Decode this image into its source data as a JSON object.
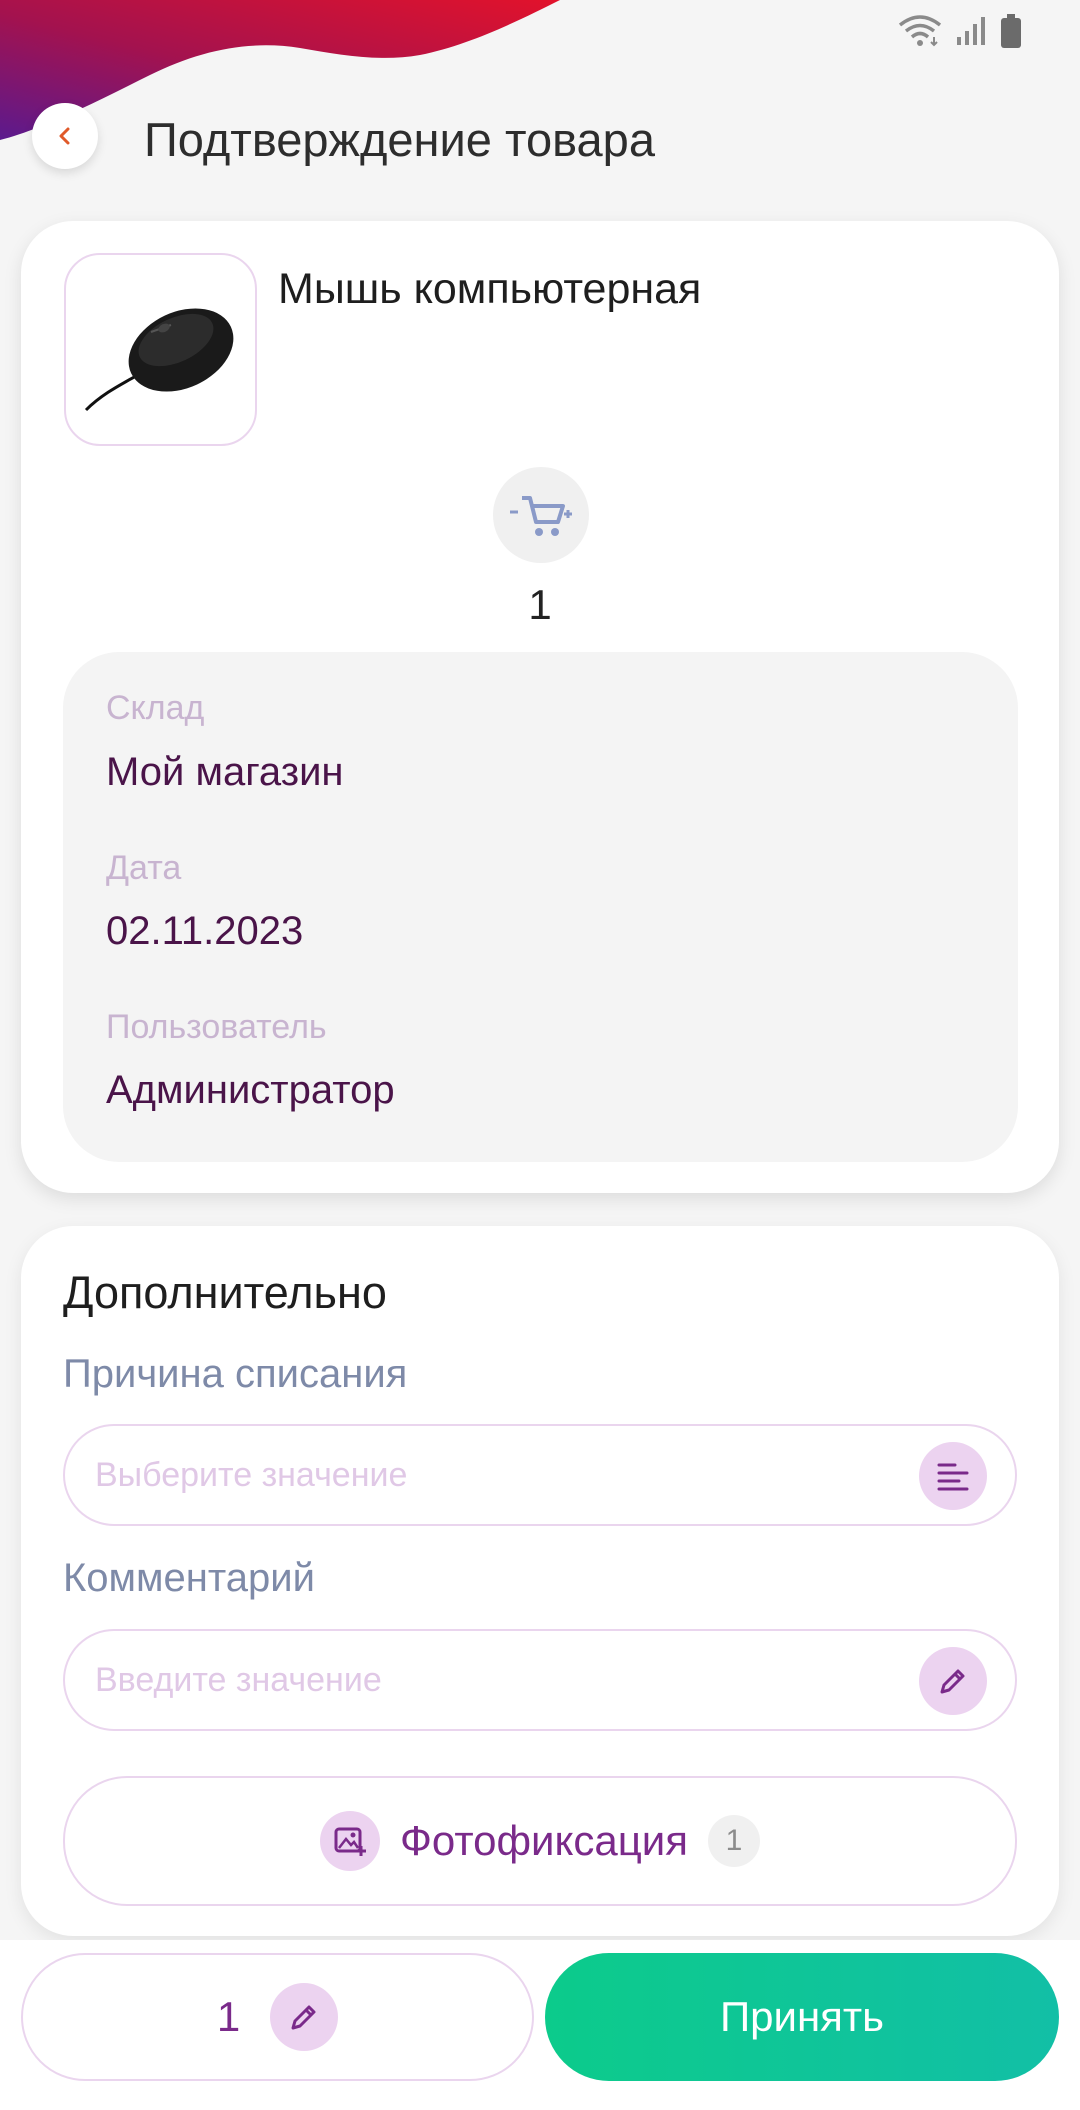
{
  "header": {
    "title": "Подтверждение товара"
  },
  "product": {
    "name": "Мышь компьютерная",
    "quantity": "1"
  },
  "info": {
    "warehouse_label": "Склад",
    "warehouse_value": "Мой магазин",
    "date_label": "Дата",
    "date_value": "02.11.2023",
    "user_label": "Пользователь",
    "user_value": "Администратор"
  },
  "additional": {
    "title": "Дополнительно",
    "reason_label": "Причина списания",
    "reason_placeholder": "Выберите значение",
    "comment_label": "Комментарий",
    "comment_placeholder": "Введите значение",
    "photo_label": "Фотофиксация",
    "photo_count": "1"
  },
  "bottom": {
    "quantity": "1",
    "accept_label": "Принять"
  },
  "colors": {
    "accent_purple": "#7a2a8a",
    "accept_green": "#0ccb8b",
    "value_text": "#4a1449",
    "wave_red": "#d6102f"
  }
}
